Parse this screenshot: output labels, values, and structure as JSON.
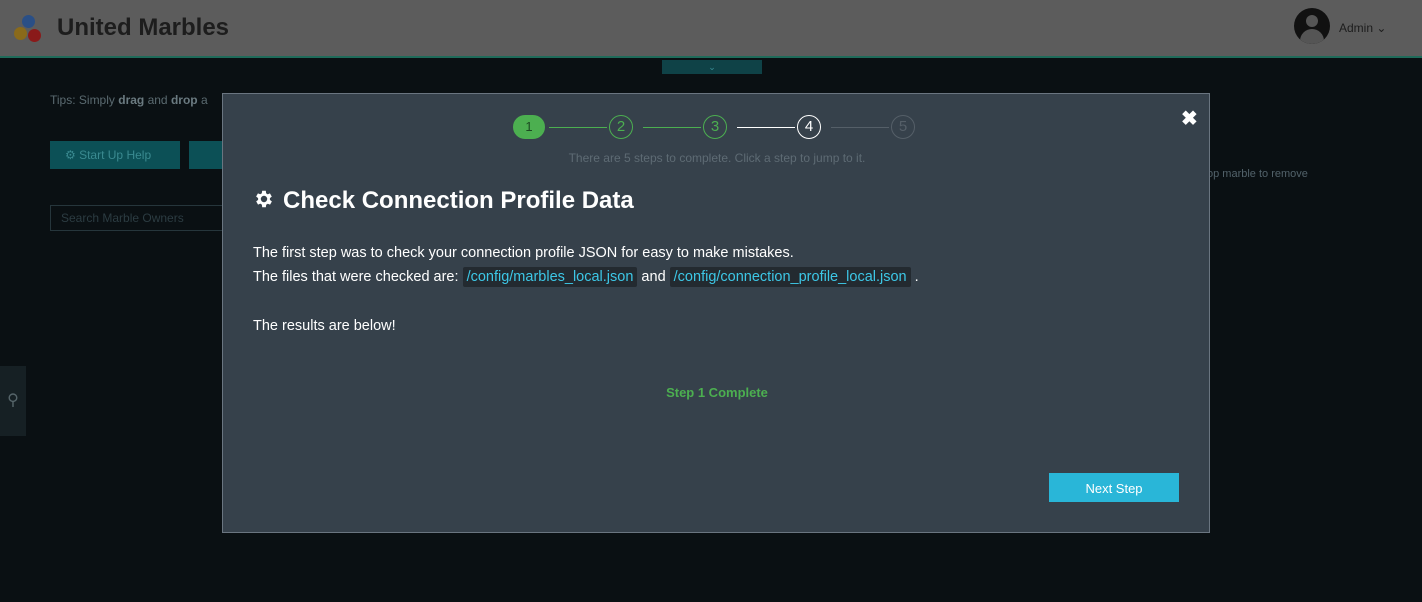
{
  "header": {
    "brand": "United Marbles",
    "user": "Admin ⌄",
    "toggle_icon": "⌄"
  },
  "background": {
    "tips_prefix": "Tips: Simply ",
    "tips_drag": "drag",
    "tips_and": " and ",
    "tips_drop": "drop",
    "tips_suffix": " a",
    "startup_button": "Start Up Help",
    "search_placeholder": "Search Marble Owners",
    "hint_text": "op marble to remove",
    "side_icon": "⚲"
  },
  "modal": {
    "close_label": "✖",
    "steps": [
      "1",
      "2",
      "3",
      "4",
      "5"
    ],
    "step_hint": "There are 5 steps to complete. Click a step to jump to it.",
    "title": "Check Connection Profile Data",
    "line1": "The first step was to check your connection profile JSON for easy to make mistakes.",
    "line2_prefix": "The files that were checked are: ",
    "file1": "/config/marbles_local.json",
    "line2_and": " and ",
    "file2": "/config/connection_profile_local.json",
    "line2_suffix": " .",
    "results": "The results are below!",
    "status": "Step 1 Complete",
    "next_button": "Next Step"
  },
  "colors": {
    "accent": "#29b6d8",
    "success": "#4caf50",
    "modal_bg": "#36414b",
    "code_text": "#3dc7e6"
  }
}
